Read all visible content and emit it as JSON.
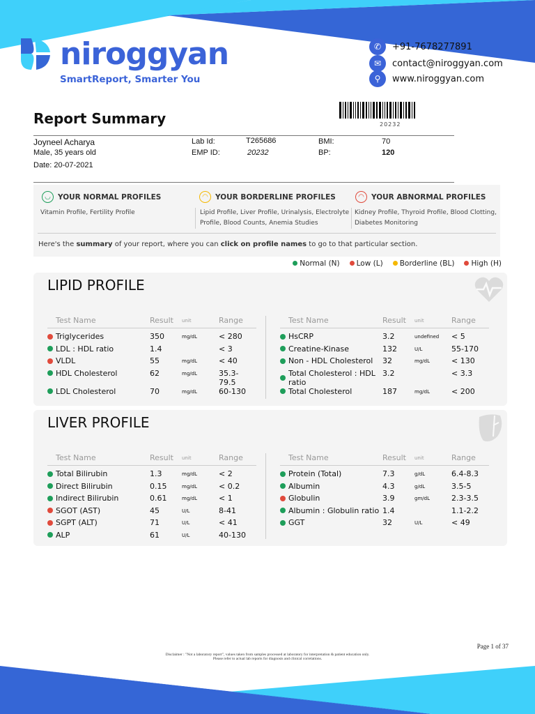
{
  "brand": {
    "name": "niroggyan",
    "tagline": "SmartReport, Smarter You",
    "colors": {
      "primary": "#3b63d8",
      "cyan": "#3fd0fa"
    }
  },
  "contact": {
    "phone": "+91-7678277891",
    "email": "contact@niroggyan.com",
    "website": "www.niroggyan.com"
  },
  "report": {
    "title": "Report Summary",
    "barcode_number": "20232"
  },
  "patient": {
    "name": "Joyneel Acharya",
    "gender_age": "Male, 35 years old",
    "date": "Date: 20-07-2021",
    "lab_id_label": "Lab Id:",
    "lab_id": "T265686",
    "emp_id_label": "EMP ID:",
    "emp_id": "20232",
    "bmi_label": "BMI:",
    "bmi": "70",
    "bp_label": "BP:",
    "bp": "120"
  },
  "profiles": {
    "normal": {
      "title": "YOUR NORMAL PROFILES",
      "items": "Vitamin Profile, Fertility Profile"
    },
    "borderline": {
      "title": "YOUR BORDERLINE PROFILES",
      "items": "Lipid Profile, Liver Profile, Urinalysis, Electrolyte Profile, Blood Counts, Anemia Studies"
    },
    "abnormal": {
      "title": "YOUR ABNORMAL PROFILES",
      "items": "Kidney Profile, Thyroid Profile, Blood Clotting, Diabetes Monitoring"
    },
    "summary_pre": "Here's the ",
    "summary_b1": "summary",
    "summary_mid": " of your report, where you can ",
    "summary_b2": "click on profile names",
    "summary_post": " to go to that particular section."
  },
  "legend": [
    {
      "label": "Normal (N)",
      "color": "#1e9e5a"
    },
    {
      "label": "Low (L)",
      "color": "#e04a3c"
    },
    {
      "label": "Borderline (BL)",
      "color": "#f5b800"
    },
    {
      "label": "High (H)",
      "color": "#e04a3c"
    }
  ],
  "headers": {
    "name": "Test Name",
    "result": "Result",
    "unit": "unit",
    "range": "Range"
  },
  "sections": [
    {
      "title": "LIPID PROFILE",
      "icon": "heart-pulse-icon",
      "left": [
        {
          "name": "Triglycerides",
          "result": "350",
          "unit": "mg/dL",
          "range": "< 280",
          "status": "high"
        },
        {
          "name": "LDL : HDL ratio",
          "result": "1.4",
          "unit": "",
          "range": "< 3",
          "status": "normal"
        },
        {
          "name": "VLDL",
          "result": "55",
          "unit": "mg/dL",
          "range": "< 40",
          "status": "high"
        },
        {
          "name": "HDL Cholesterol",
          "result": "62",
          "unit": "mg/dL",
          "range": "35.3-79.5",
          "status": "normal"
        },
        {
          "name": "LDL Cholesterol",
          "result": "70",
          "unit": "mg/dL",
          "range": "60-130",
          "status": "normal"
        }
      ],
      "right": [
        {
          "name": "HsCRP",
          "result": "3.2",
          "unit": "undefined",
          "range": "< 5",
          "status": "normal"
        },
        {
          "name": "Creatine-Kinase",
          "result": "132",
          "unit": "U/L",
          "range": "55-170",
          "status": "normal"
        },
        {
          "name": "Non - HDL Cholesterol",
          "result": "32",
          "unit": "mg/dL",
          "range": "< 130",
          "status": "normal"
        },
        {
          "name": "Total Cholesterol : HDL ratio",
          "result": "3.2",
          "unit": "",
          "range": "< 3.3",
          "status": "normal"
        },
        {
          "name": "Total Cholesterol",
          "result": "187",
          "unit": "mg/dL",
          "range": "< 200",
          "status": "normal"
        }
      ]
    },
    {
      "title": "LIVER PROFILE",
      "icon": "liver-icon",
      "left": [
        {
          "name": "Total Bilirubin",
          "result": "1.3",
          "unit": "mg/dL",
          "range": "< 2",
          "status": "normal"
        },
        {
          "name": "Direct Bilirubin",
          "result": "0.15",
          "unit": "mg/dL",
          "range": "< 0.2",
          "status": "normal"
        },
        {
          "name": "Indirect Bilirubin",
          "result": "0.61",
          "unit": "mg/dL",
          "range": "< 1",
          "status": "normal"
        },
        {
          "name": "SGOT (AST)",
          "result": "45",
          "unit": "U/L",
          "range": "8-41",
          "status": "high"
        },
        {
          "name": "SGPT (ALT)",
          "result": "71",
          "unit": "U/L",
          "range": "< 41",
          "status": "high"
        },
        {
          "name": "ALP",
          "result": "61",
          "unit": "U/L",
          "range": "40-130",
          "status": "normal"
        }
      ],
      "right": [
        {
          "name": "Protein (Total)",
          "result": "7.3",
          "unit": "g/dL",
          "range": "6.4-8.3",
          "status": "normal"
        },
        {
          "name": "Albumin",
          "result": "4.3",
          "unit": "g/dL",
          "range": "3.5-5",
          "status": "normal"
        },
        {
          "name": "Globulin",
          "result": "3.9",
          "unit": "gm/dL",
          "range": "2.3-3.5",
          "status": "high"
        },
        {
          "name": "Albumin : Globulin ratio",
          "result": "1.4",
          "unit": "",
          "range": "1.1-2.2",
          "status": "normal"
        },
        {
          "name": "GGT",
          "result": "32",
          "unit": "U/L",
          "range": "< 49",
          "status": "normal"
        }
      ]
    }
  ],
  "footer": {
    "page": "Page 1 of 37",
    "disclaimer1": "Disclaimer : \"Not a laboratory report\", values taken from samples processed at laboratory for interpretation & patient education only.",
    "disclaimer2": "Please refer to actual lab reports for diagnosis and clinical correlations."
  }
}
